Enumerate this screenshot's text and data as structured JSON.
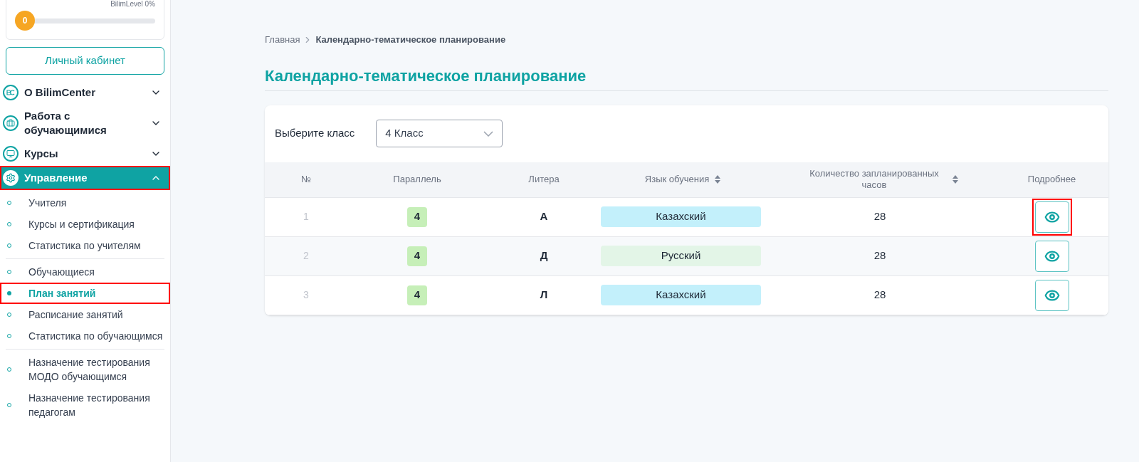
{
  "sidebar": {
    "level": {
      "badge": "0",
      "label": "BilimLevel 0%",
      "level": 0
    },
    "cabinet_button": "Личный кабинет",
    "menu": [
      {
        "label": "О BilimCenter",
        "expanded": false,
        "selected": false,
        "highlighted": false
      },
      {
        "label": "Работа с обучающимися",
        "expanded": false,
        "selected": false,
        "highlighted": false
      },
      {
        "label": "Курсы",
        "expanded": false,
        "selected": false,
        "highlighted": false
      },
      {
        "label": "Управление",
        "expanded": true,
        "selected": true,
        "highlighted": true,
        "groups": [
          [
            {
              "label": "Учителя",
              "selected": false,
              "highlighted": false
            },
            {
              "label": "Курсы и сертификация",
              "selected": false,
              "highlighted": false
            },
            {
              "label": "Статистика по учителям",
              "selected": false,
              "highlighted": false
            }
          ],
          [
            {
              "label": "Обучающиеся",
              "selected": false,
              "highlighted": false
            },
            {
              "label": "План занятий",
              "selected": true,
              "highlighted": true
            },
            {
              "label": "Расписание занятий",
              "selected": false,
              "highlighted": false
            },
            {
              "label": "Статистика по обучающимся",
              "selected": false,
              "highlighted": false
            }
          ],
          [
            {
              "label": "Назначение тестирования МОДО обучающимся",
              "selected": false,
              "highlighted": false
            },
            {
              "label": "Назначение тестирования педагогам",
              "selected": false,
              "highlighted": false
            }
          ]
        ]
      }
    ]
  },
  "breadcrumb": [
    {
      "label": "Главная",
      "current": false
    },
    {
      "label": "Календарно-тематическое планирование",
      "current": true
    }
  ],
  "title": "Календарно-тематическое планирование",
  "filter": {
    "label": "Выберите класс",
    "value": "4 Класс"
  },
  "table": {
    "columns": [
      {
        "label": "№",
        "sortable": false
      },
      {
        "label": "Параллель",
        "sortable": false
      },
      {
        "label": "Литера",
        "sortable": false
      },
      {
        "label": "Язык обучения",
        "sortable": true
      },
      {
        "label": "Количество запланированных часов",
        "sortable": true
      },
      {
        "label": "Подробнее",
        "sortable": false
      }
    ],
    "rows": [
      {
        "number": "1",
        "parallel": "4",
        "letter": "А",
        "language": "Казахский",
        "color": "#c3f0fb",
        "hours": "28",
        "highlighted": true
      },
      {
        "number": "2",
        "parallel": "4",
        "letter": "Д",
        "language": "Русский",
        "color": "#e3f5e7",
        "hours": "28",
        "highlighted": false
      },
      {
        "number": "3",
        "parallel": "4",
        "letter": "Л",
        "language": "Казахский",
        "color": "#c3f0fb",
        "hours": "28",
        "highlighted": false
      }
    ]
  }
}
